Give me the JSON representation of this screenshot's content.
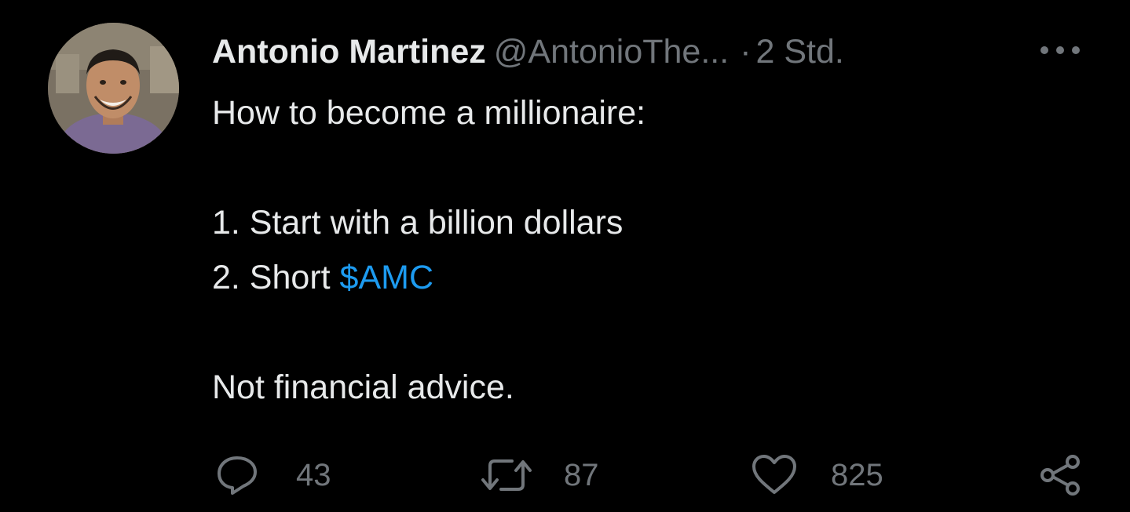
{
  "tweet": {
    "display_name": "Antonio Martinez",
    "handle": "@AntonioThe...",
    "separator": "·",
    "time": "2 Std.",
    "lines": [
      "How to become a millionaire:",
      "1. Start with a billion dollars"
    ],
    "line3_prefix": "2. Short ",
    "cashtag": "$AMC",
    "closing": "Not financial advice."
  },
  "actions": {
    "replies": "43",
    "retweets": "87",
    "likes": "825"
  },
  "colors": {
    "background": "#000000",
    "text": "#e7e9ea",
    "secondary": "#71767b",
    "link": "#1d9bf0"
  },
  "icons": {
    "reply": "reply-icon",
    "retweet": "retweet-icon",
    "like": "heart-icon",
    "share": "share-icon",
    "more": "more-icon"
  }
}
